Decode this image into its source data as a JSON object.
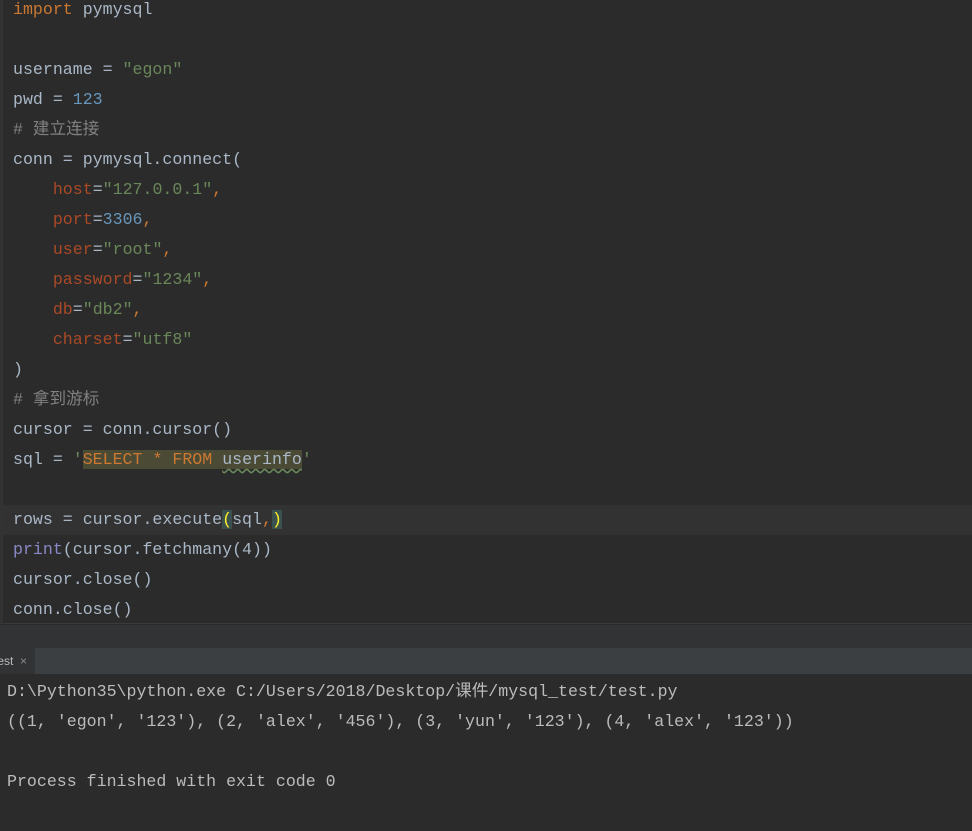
{
  "editor": {
    "lines": [
      [
        {
          "t": "import",
          "c": "kw"
        },
        {
          "t": " pymysql"
        }
      ],
      [],
      [
        {
          "t": "username = "
        },
        {
          "t": "\"egon\"",
          "c": "str"
        }
      ],
      [
        {
          "t": "pwd = "
        },
        {
          "t": "123",
          "c": "num"
        }
      ],
      [
        {
          "t": "# 建立连接",
          "c": "cm"
        }
      ],
      [
        {
          "t": "conn = pymysql.connect("
        }
      ],
      [
        {
          "t": "    "
        },
        {
          "t": "host",
          "c": "kwarg"
        },
        {
          "t": "="
        },
        {
          "t": "\"127.0.0.1\"",
          "c": "str"
        },
        {
          "t": ",",
          "c": "kw"
        }
      ],
      [
        {
          "t": "    "
        },
        {
          "t": "port",
          "c": "kwarg"
        },
        {
          "t": "="
        },
        {
          "t": "3306",
          "c": "num"
        },
        {
          "t": ",",
          "c": "kw"
        }
      ],
      [
        {
          "t": "    "
        },
        {
          "t": "user",
          "c": "kwarg"
        },
        {
          "t": "="
        },
        {
          "t": "\"root\"",
          "c": "str"
        },
        {
          "t": ",",
          "c": "kw"
        }
      ],
      [
        {
          "t": "    "
        },
        {
          "t": "password",
          "c": "kwarg"
        },
        {
          "t": "="
        },
        {
          "t": "\"1234\"",
          "c": "str"
        },
        {
          "t": ",",
          "c": "kw"
        }
      ],
      [
        {
          "t": "    "
        },
        {
          "t": "db",
          "c": "kwarg"
        },
        {
          "t": "="
        },
        {
          "t": "\"db2\"",
          "c": "str"
        },
        {
          "t": ",",
          "c": "kw"
        }
      ],
      [
        {
          "t": "    "
        },
        {
          "t": "charset",
          "c": "kwarg"
        },
        {
          "t": "="
        },
        {
          "t": "\"utf8\"",
          "c": "str"
        }
      ],
      [
        {
          "t": ")"
        }
      ],
      [
        {
          "t": "# 拿到游标",
          "c": "cm"
        }
      ],
      [
        {
          "t": "cursor = conn.cursor()"
        }
      ],
      [
        {
          "t": "sql = "
        },
        {
          "t": "'",
          "c": "str"
        },
        {
          "t": "SELECT",
          "c": "sqlkw"
        },
        {
          "t": " ",
          "c": "sqlhl"
        },
        {
          "t": "*",
          "c": "sqlkw"
        },
        {
          "t": " ",
          "c": "sqlhl"
        },
        {
          "t": "FROM",
          "c": "sqlkw"
        },
        {
          "t": " ",
          "c": "sqlhl"
        },
        {
          "t": "userinfo",
          "c": "sqlid"
        },
        {
          "t": "'",
          "c": "str"
        }
      ],
      [],
      [
        {
          "t": "rows = cursor.execute"
        },
        {
          "t": "(",
          "c": "brace"
        },
        {
          "t": "sql"
        },
        {
          "t": ",",
          "c": "kw"
        },
        {
          "t": ")",
          "c": "brace"
        }
      ],
      [
        {
          "t": "print",
          "c": "bi"
        },
        {
          "t": "(cursor.fetchmany(4))"
        }
      ],
      [
        {
          "t": "cursor.close()"
        }
      ],
      [
        {
          "t": "conn.close()"
        }
      ]
    ],
    "current_line": 17
  },
  "run_tab": {
    "label": "test",
    "close": "×"
  },
  "console": {
    "lines": [
      "D:\\Python35\\python.exe C:/Users/2018/Desktop/课件/mysql_test/test.py",
      "((1, 'egon', '123'), (2, 'alex', '456'), (3, 'yun', '123'), (4, 'alex', '123'))",
      "",
      "Process finished with exit code 0"
    ]
  }
}
